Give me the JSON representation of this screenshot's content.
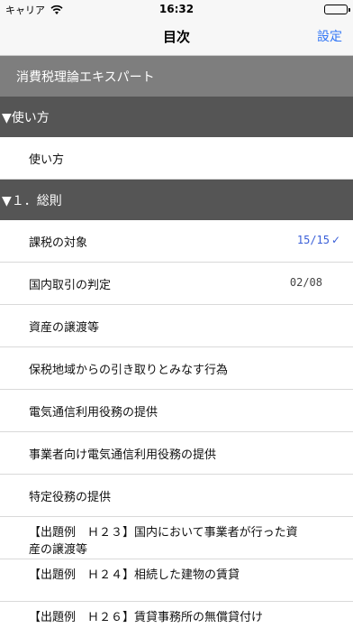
{
  "status_bar": {
    "carrier": "キャリア",
    "time": "16:32"
  },
  "nav": {
    "title": "目次",
    "settings_label": "設定"
  },
  "book_title": "消費税理論エキスパート",
  "sections": [
    {
      "header": "▼使い方"
    },
    {
      "header": "▼１．総則"
    }
  ],
  "rows": [
    {
      "label": "使い方"
    },
    {
      "label": "課税の対象",
      "progress": "15/15",
      "completed": true
    },
    {
      "label": "国内取引の判定",
      "progress": "02/08",
      "completed": false
    },
    {
      "label": "資産の譲渡等"
    },
    {
      "label": "保税地域からの引き取りとみなす行為"
    },
    {
      "label": "電気通信利用役務の提供"
    },
    {
      "label": "事業者向け電気通信利用役務の提供"
    },
    {
      "label": "特定役務の提供"
    },
    {
      "label": "【出題例　Ｈ２３】国内において事業者が行った資産の譲渡等"
    },
    {
      "label": "【出題例　Ｈ２４】相続した建物の賃貸"
    },
    {
      "label": "【出題例　Ｈ２６】賃貸事務所の無償貸付け"
    }
  ],
  "icons": {
    "wifi": "wifi-icon",
    "battery": "battery-icon",
    "check": "checkmark-icon"
  }
}
